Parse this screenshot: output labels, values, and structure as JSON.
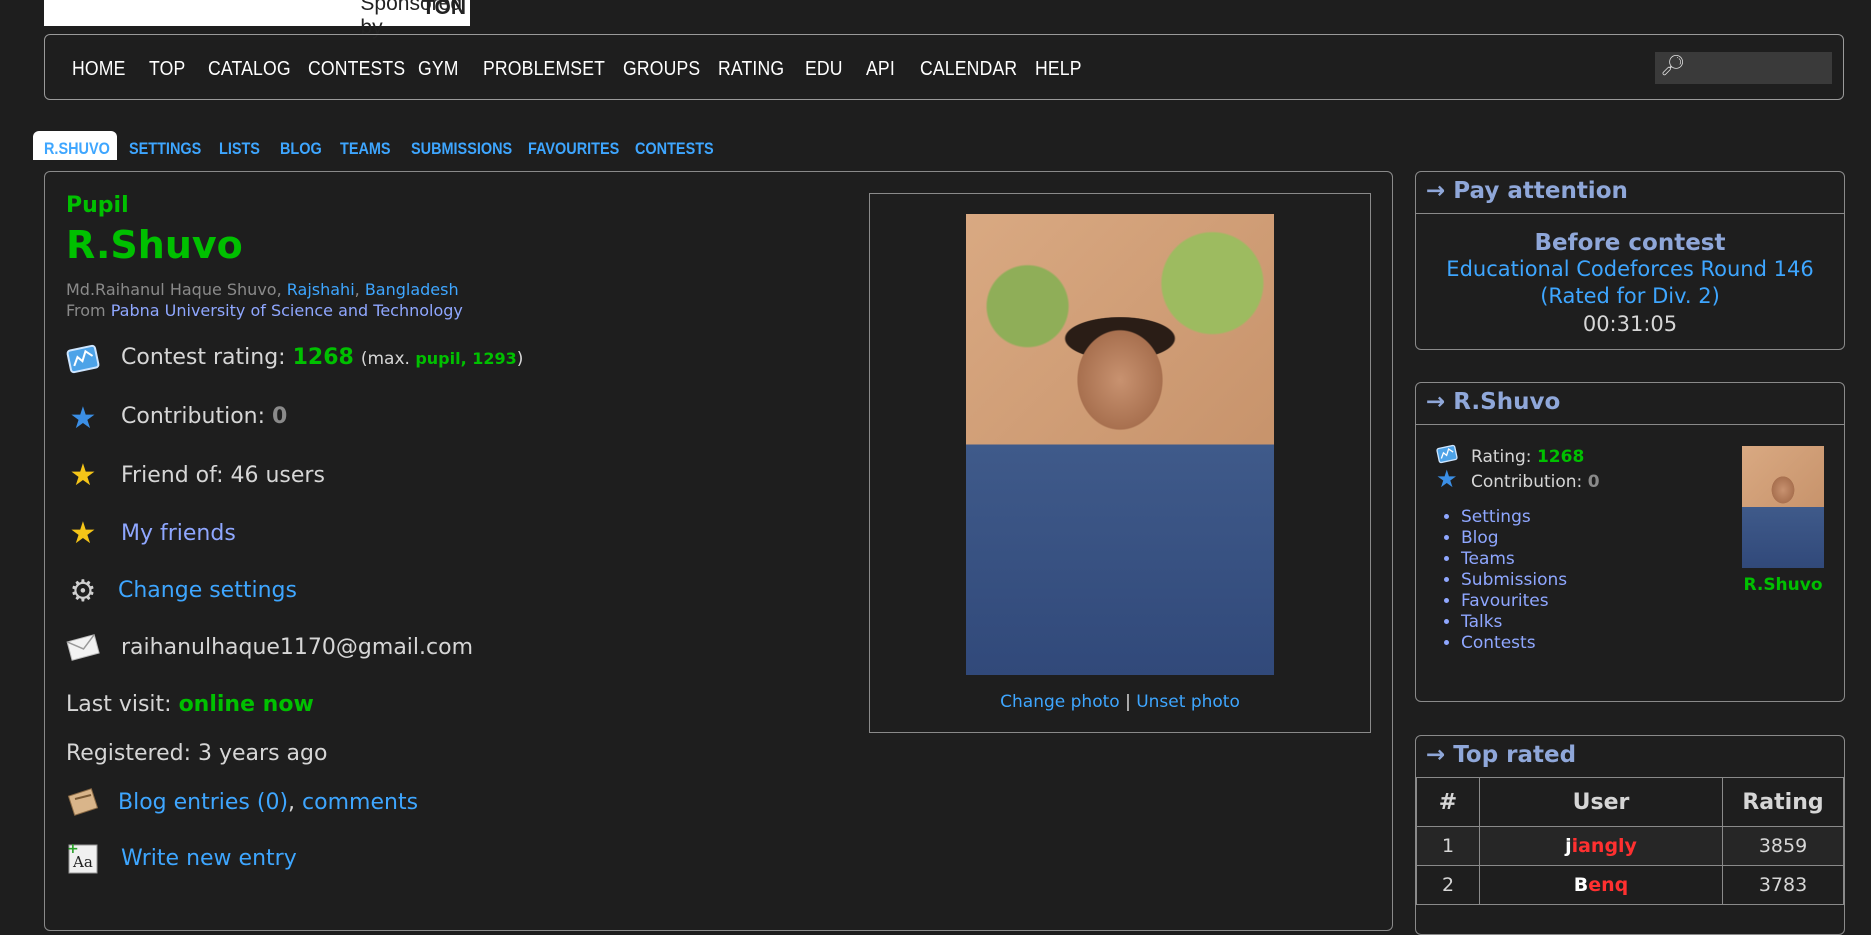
{
  "sponsor": {
    "prefix": "Sponsored by ",
    "brand": "TON"
  },
  "menu": {
    "items": [
      "HOME",
      "TOP",
      "CATALOG",
      "CONTESTS",
      "GYM",
      "PROBLEMSET",
      "GROUPS",
      "RATING",
      "EDU",
      "API",
      "CALENDAR",
      "HELP"
    ],
    "search_placeholder": ""
  },
  "tabs": [
    "R.SHUVO",
    "SETTINGS",
    "LISTS",
    "BLOG",
    "TEAMS",
    "SUBMISSIONS",
    "FAVOURITES",
    "CONTESTS"
  ],
  "profile": {
    "rank": "Pupil",
    "handle": "R.Shuvo",
    "full_name": "Md.Raihanul Haque Shuvo",
    "city": "Rajshahi",
    "country": "Bangladesh",
    "from_label": "From ",
    "organization": "Pabna University of Science and Technology",
    "rating_label": "Contest rating: ",
    "rating": "1268",
    "max_prefix": "(max. ",
    "max_rank": "pupil, 1293",
    "max_suffix": ")",
    "contribution_label": "Contribution: ",
    "contribution": "0",
    "friend_of": "Friend of: 46 users",
    "my_friends": "My friends",
    "change_settings": "Change settings",
    "email": "raihanulhaque1170@gmail.com",
    "last_visit_label": "Last visit: ",
    "last_visit": "online now",
    "registered": "Registered: 3 years ago",
    "blog_entries": "Blog entries (0)",
    "comments": "comments",
    "write_entry": "Write new entry",
    "change_photo": "Change photo",
    "unset_photo": "Unset photo",
    "photo_sep": "|",
    "comma": ", "
  },
  "pay_attention": {
    "title": "→ Pay attention",
    "heading": "Before contest",
    "contest": "Educational Codeforces Round 146",
    "contest_sub": "(Rated for Div. 2)",
    "countdown": "00:31:05"
  },
  "user_box": {
    "title": "→ R.Shuvo",
    "rating_label": "Rating: ",
    "rating": "1268",
    "contribution_label": "Contribution: ",
    "contribution": "0",
    "links": [
      "Settings",
      "Blog",
      "Teams",
      "Submissions",
      "Favourites",
      "Talks",
      "Contests"
    ],
    "handle": "R.Shuvo"
  },
  "top_rated": {
    "title": "→ Top rated",
    "headers": [
      "#",
      "User",
      "Rating"
    ],
    "rows": [
      {
        "rank": "1",
        "first": "j",
        "rest": "iangly",
        "rating": "3859"
      },
      {
        "rank": "2",
        "first": "B",
        "rest": "enq",
        "rating": "3783"
      }
    ]
  },
  "colors": {
    "rank_green": "#00c000",
    "link_blue": "#3ea6ff",
    "legend_red": "#ff3030"
  }
}
